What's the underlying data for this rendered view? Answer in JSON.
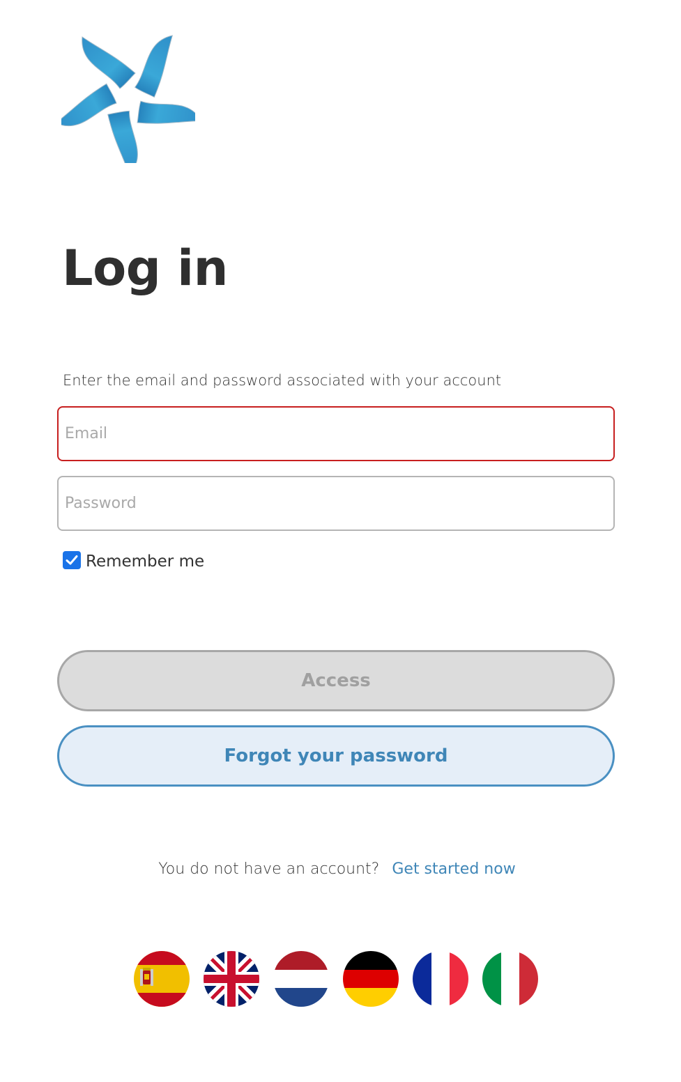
{
  "logo": {
    "icon": "pinwheel-logo-icon",
    "colors": [
      "#1f78b8",
      "#3aa8d8",
      "#6cc4e4"
    ]
  },
  "page": {
    "title": "Log in",
    "subtitle": "Enter the email and password associated with your account"
  },
  "form": {
    "email": {
      "placeholder": "Email",
      "value": "",
      "border_color": "#c71f1f"
    },
    "password": {
      "placeholder": "Password",
      "value": ""
    },
    "remember_me": {
      "label": "Remember me",
      "checked": true
    }
  },
  "buttons": {
    "access": "Access",
    "forgot": "Forgot your password"
  },
  "signup": {
    "question": "You do not have an account?",
    "link": "Get started now"
  },
  "languages": [
    {
      "code": "es",
      "icon": "spain-flag-icon"
    },
    {
      "code": "en",
      "icon": "uk-flag-icon"
    },
    {
      "code": "nl",
      "icon": "netherlands-flag-icon"
    },
    {
      "code": "de",
      "icon": "germany-flag-icon"
    },
    {
      "code": "fr",
      "icon": "france-flag-icon"
    },
    {
      "code": "it",
      "icon": "italy-flag-icon"
    }
  ],
  "colors": {
    "accent": "#3f86b7",
    "error": "#c71f1f",
    "disabled_bg": "#dcdcdc",
    "checkbox": "#1a73e8"
  }
}
